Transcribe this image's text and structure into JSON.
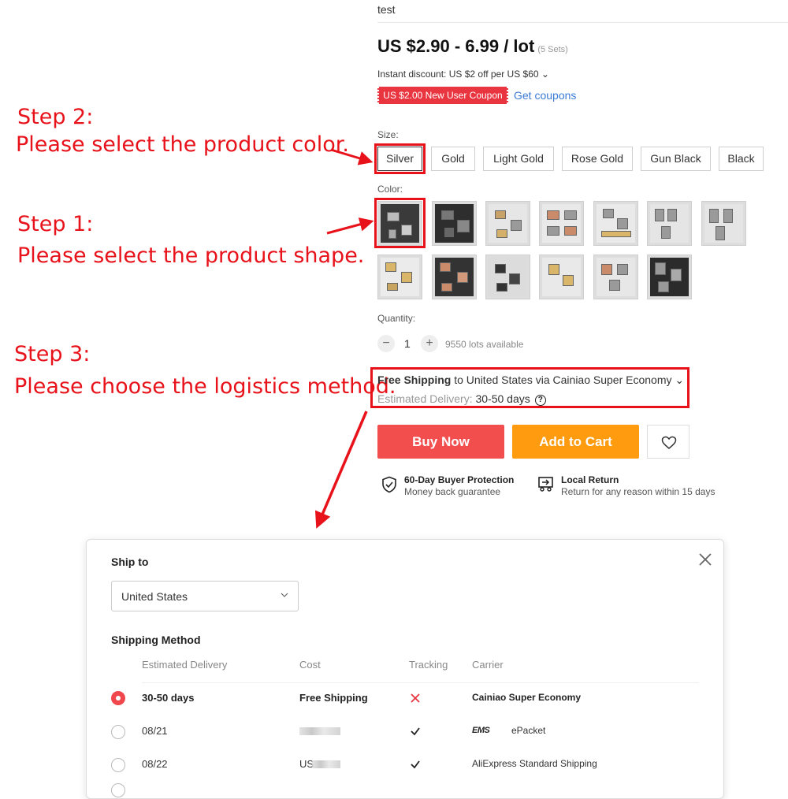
{
  "annotations": {
    "step2_title": "Step 2:",
    "step2_text": "Please select the product color.",
    "step1_title": "Step 1:",
    "step1_text": "Please select the product shape.",
    "step3_title": "Step 3:",
    "step3_text": "Please choose the logistics method.",
    "accent_color": "#e8121b"
  },
  "product": {
    "title": "test",
    "price": "US $2.90 - 6.99 / lot",
    "price_note": "(5 Sets)",
    "instant_discount": "Instant discount: US $2 off per US $60 ⌄",
    "coupon_label": "US $2.00 New User Coupon",
    "get_coupons": "Get coupons",
    "size_label": "Size:",
    "sizes": [
      "Silver",
      "Gold",
      "Light Gold",
      "Rose Gold",
      "Gun Black",
      "Black"
    ],
    "selected_size": "Silver",
    "color_label": "Color:",
    "selected_color_index": 0,
    "quantity_label": "Quantity:",
    "quantity_minus": "−",
    "quantity_value": "1",
    "quantity_plus": "+",
    "lots_available": "9550 lots available",
    "shipping_bold": "Free Shipping",
    "shipping_rest": " to United States via Cainiao Super Economy ⌄",
    "delivery_label": "Estimated Delivery: ",
    "delivery_value": "30-50 days",
    "buy_now": "Buy Now",
    "add_to_cart": "Add to Cart",
    "buy_color": "#f24e4e",
    "cart_color": "#ff9b0f",
    "protection_title": "60-Day Buyer Protection",
    "protection_sub": "Money back guarantee",
    "return_title": "Local Return",
    "return_sub": "Return for any reason within 15 days"
  },
  "modal": {
    "ship_to_label": "Ship to",
    "country": "United States",
    "shipping_method_label": "Shipping Method",
    "headers": [
      "Estimated Delivery",
      "Cost",
      "Tracking",
      "Carrier"
    ],
    "rows": [
      {
        "delivery": "30-50 days",
        "cost": "Free Shipping",
        "tracking": "no",
        "carrier": "Cainiao Super Economy",
        "selected": true
      },
      {
        "delivery": "08/21",
        "cost": "",
        "tracking": "yes",
        "carrier_logo": "EMS",
        "carrier": "ePacket",
        "selected": false
      },
      {
        "delivery": "08/22",
        "cost": "US",
        "tracking": "yes",
        "carrier": "AliExpress Standard Shipping",
        "selected": false
      }
    ]
  }
}
